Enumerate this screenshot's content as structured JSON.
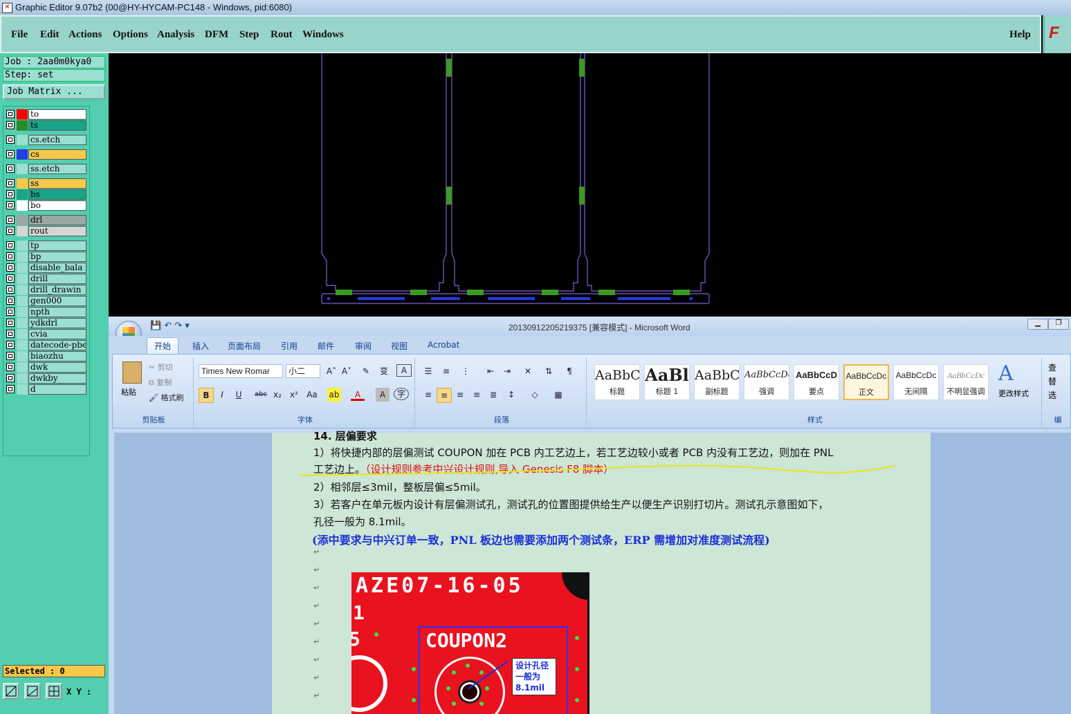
{
  "titlebar": {
    "title": "Graphic Editor 9.07b2 (00@HY-HYCAM-PC148 - Windows, pid:6080)"
  },
  "menubar": {
    "items": [
      "File",
      "Edit",
      "Actions",
      "Options",
      "Analysis",
      "DFM",
      "Step",
      "Rout",
      "Windows"
    ],
    "help": "Help",
    "logo": "F"
  },
  "job": {
    "job_label": "Job : 2aa0m0kya0",
    "step_label": "Step: set",
    "matrix_button": "Job Matrix ..."
  },
  "layers": [
    {
      "name": "to",
      "color": "#ff0000",
      "bg": "#ffffff"
    },
    {
      "name": "ts",
      "color": "#2a8a2a",
      "bg": "#1aa58a"
    },
    {
      "name": "cs.etch",
      "color": "",
      "bg": "#9bded2"
    },
    {
      "name": "cs",
      "color": "#1f3fe0",
      "bg": "#f7c84a"
    },
    {
      "name": "ss.etch",
      "color": "",
      "bg": "#9bded2"
    },
    {
      "name": "ss",
      "color": "",
      "bg": "#f7c84a"
    },
    {
      "name": "bs",
      "color": "",
      "bg": "#1aa58a"
    },
    {
      "name": "bo",
      "color": "",
      "bg": "#ffffff"
    },
    {
      "name": "drl",
      "color": "",
      "bg": "#9aa7a4"
    },
    {
      "name": "rout",
      "color": "",
      "bg": "#d6d6d6"
    },
    {
      "name": "tp",
      "color": "",
      "bg": "#9bded2"
    },
    {
      "name": "bp",
      "color": "",
      "bg": "#9bded2"
    },
    {
      "name": "disable_bala",
      "color": "",
      "bg": "#9bded2"
    },
    {
      "name": "drill",
      "color": "",
      "bg": "#9bded2"
    },
    {
      "name": "drill_drawin",
      "color": "",
      "bg": "#9bded2"
    },
    {
      "name": "gen000",
      "color": "",
      "bg": "#9bded2"
    },
    {
      "name": "npth",
      "color": "",
      "bg": "#9bded2"
    },
    {
      "name": "ydkdrl",
      "color": "",
      "bg": "#9bded2"
    },
    {
      "name": "cvia",
      "color": "",
      "bg": "#9bded2"
    },
    {
      "name": "datecode-pbe",
      "color": "",
      "bg": "#9bded2"
    },
    {
      "name": "biaozhu",
      "color": "",
      "bg": "#9bded2"
    },
    {
      "name": "dwk",
      "color": "",
      "bg": "#9bded2"
    },
    {
      "name": "dwkby",
      "color": "",
      "bg": "#9bded2"
    },
    {
      "name": "d",
      "color": "",
      "bg": "#9bded2"
    }
  ],
  "status": {
    "selected": "Selected : 0",
    "xy": "X Y :"
  },
  "word": {
    "title": "20130912205219375 [兼容模式] - Microsoft Word",
    "tabs": [
      "开始",
      "插入",
      "页面布局",
      "引用",
      "邮件",
      "审阅",
      "视图",
      "Acrobat"
    ],
    "clipboard": {
      "paste": "粘贴",
      "cut": "剪切",
      "copy": "复制",
      "format_painter": "格式刷",
      "group": "剪贴板"
    },
    "font": {
      "name": "Times New Romar",
      "size": "小二",
      "group": "字体"
    },
    "paragraph": {
      "group": "段落"
    },
    "styles": {
      "group": "样式",
      "items": [
        {
          "preview": "AaBbC",
          "label": "标题"
        },
        {
          "preview": "AaBl",
          "label": "标题 1"
        },
        {
          "preview": "AaBbC",
          "label": "副标题"
        },
        {
          "preview": "AaBbCcDc",
          "label": "强调"
        },
        {
          "preview": "AaBbCcD",
          "label": "要点"
        },
        {
          "preview": "AaBbCcDc",
          "label": "正文"
        },
        {
          "preview": "AaBbCcDc",
          "label": "无间隔"
        },
        {
          "preview": "AaBbCcDc",
          "label": "不明显强调"
        }
      ],
      "change": "更改样式"
    },
    "editing": {
      "find": "查",
      "replace": "替",
      "select": "选",
      "group": "编"
    },
    "doc": {
      "heading": "14. 层偏要求",
      "line1": "1）将快捷内部的层偏测试 COUPON  加在 PCB 内工艺边上，若工艺边较小或者 PCB 内没有工艺边，则加在 PNL",
      "line2a": "工艺边上。",
      "line2b": "（设计规则参考中兴设计规则,导入 Genesis F8 脚本）",
      "line3": "2）相邻层≤3mil，整板层偏≤5mil。",
      "line4": "3）若客户在单元板内设计有层偏测试孔，测试孔的位置图提供给生产以便生产识别打切片。测试孔示意图如下，",
      "line5": "孔径一般为 8.1mil。",
      "line6": "(添中要求与中兴订单一致，PNL 板边也需要添加两个测试条，ERP 需增加对准度测试流程)",
      "image": {
        "code": "AZE07-16-05",
        "coupon": "COUPON2",
        "note": "设计孔径一般为8.1mil",
        "side1": "1",
        "side2": "5"
      }
    }
  }
}
